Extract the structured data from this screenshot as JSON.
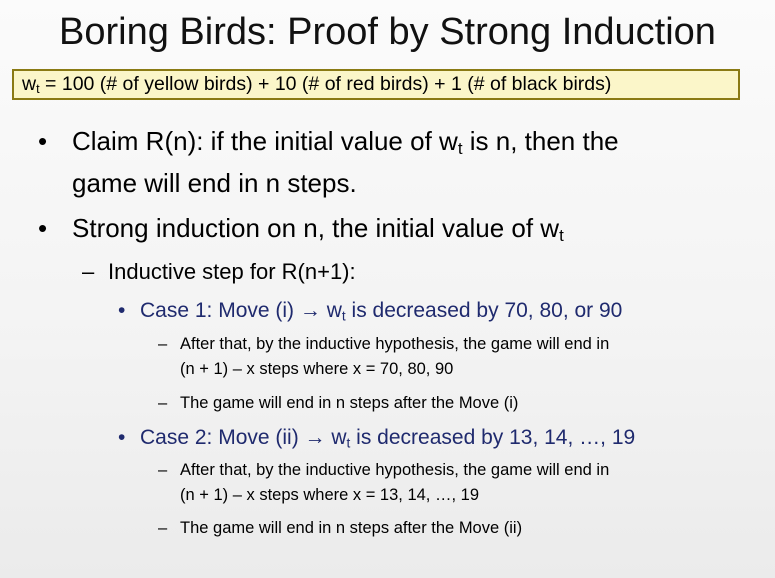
{
  "slide": {
    "title": "Boring Birds: Proof by Strong Induction",
    "formula": {
      "w": "w",
      "t": "t",
      "rest": " = 100 (# of yellow birds) + 10 (# of red birds) + 1 (# of black birds)"
    },
    "bullets": [
      {
        "symbol": "•",
        "line1": "Claim R(n): if the initial value of w",
        "sub": "t",
        "line1_end": " is n, then the",
        "line2": "game will end in n steps."
      },
      {
        "symbol": "•",
        "text": "Strong induction on n, the initial value of w",
        "sub": "t"
      }
    ],
    "inductive": {
      "dash": "–",
      "text": "Inductive step for R(n+1):"
    },
    "case1": {
      "symbol": "•",
      "prefix": "Case 1: Move (i) ",
      "arrow": "→",
      "w": " w",
      "sub": "t",
      "rest": " is decreased by 70, 80, or 90",
      "items": [
        {
          "dash": "–",
          "line1": "After that, by the inductive hypothesis, the game will end in",
          "line2": "(n + 1) – x steps where x = 70, 80, 90"
        },
        {
          "dash": "–",
          "line1": "The game will end in n steps after the Move (i)"
        }
      ]
    },
    "case2": {
      "symbol": "•",
      "prefix": "Case 2: Move (ii) ",
      "arrow": "→",
      "w": " w",
      "sub": "t",
      "rest": " is decreased by 13, 14, …, 19",
      "items": [
        {
          "dash": "–",
          "line1": "After that, by the inductive hypothesis, the game will end in",
          "line2": "(n + 1) – x steps where x = 13, 14, …, 19"
        },
        {
          "dash": "–",
          "line1": "The game will end in n steps after the Move (ii)"
        }
      ]
    }
  }
}
